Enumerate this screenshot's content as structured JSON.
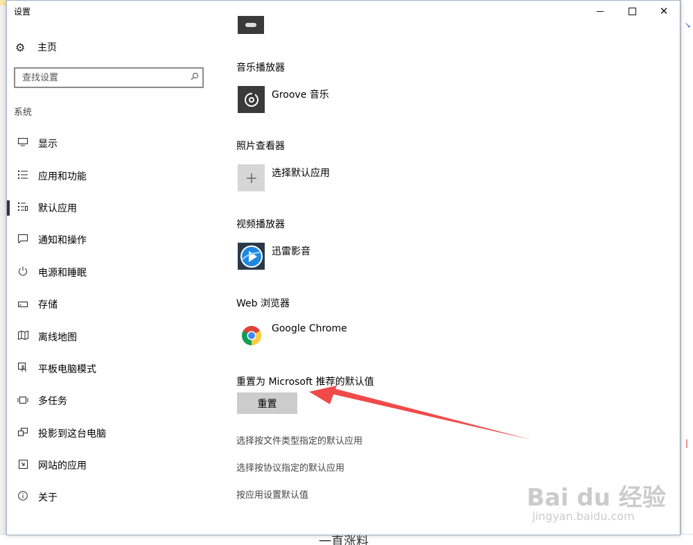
{
  "window": {
    "title": "设置",
    "controls": {
      "minimize": "minimize",
      "maximize": "maximize",
      "close": "✕"
    }
  },
  "sidebar": {
    "home_label": "主页",
    "search_placeholder": "查找设置",
    "section_label": "系统",
    "items": [
      {
        "label": "显示",
        "icon": "monitor-icon"
      },
      {
        "label": "应用和功能",
        "icon": "list-icon"
      },
      {
        "label": "默认应用",
        "icon": "default-apps-icon",
        "active": true
      },
      {
        "label": "通知和操作",
        "icon": "notification-icon"
      },
      {
        "label": "电源和睡眠",
        "icon": "power-icon"
      },
      {
        "label": "存储",
        "icon": "storage-icon"
      },
      {
        "label": "离线地图",
        "icon": "map-icon"
      },
      {
        "label": "平板电脑模式",
        "icon": "tablet-icon"
      },
      {
        "label": "多任务",
        "icon": "multitask-icon"
      },
      {
        "label": "投影到这台电脑",
        "icon": "project-icon"
      },
      {
        "label": "网站的应用",
        "icon": "web-apps-icon"
      },
      {
        "label": "关于",
        "icon": "info-icon"
      }
    ]
  },
  "content": {
    "categories": [
      {
        "label": "音乐播放器",
        "app": "Groove 音乐"
      },
      {
        "label": "照片查看器",
        "app": "选择默认应用"
      },
      {
        "label": "视频播放器",
        "app": "迅雷影音"
      },
      {
        "label": "Web 浏览器",
        "app": "Google Chrome"
      }
    ],
    "reset_label": "重置为 Microsoft 推荐的默认值",
    "reset_button": "重置",
    "links": [
      "选择按文件类型指定的默认应用",
      "选择按协议指定的默认应用",
      "按应用设置默认值"
    ]
  },
  "background": {
    "bottom_text": "一直涨料"
  },
  "watermark": {
    "text": "Bai du 经验",
    "url": "jingyan.baidu.com"
  },
  "colors": {
    "annotation_arrow": "#f04a4a",
    "reset_button_bg": "#cccccc",
    "scroll_thumb": "#c2c2c2"
  }
}
